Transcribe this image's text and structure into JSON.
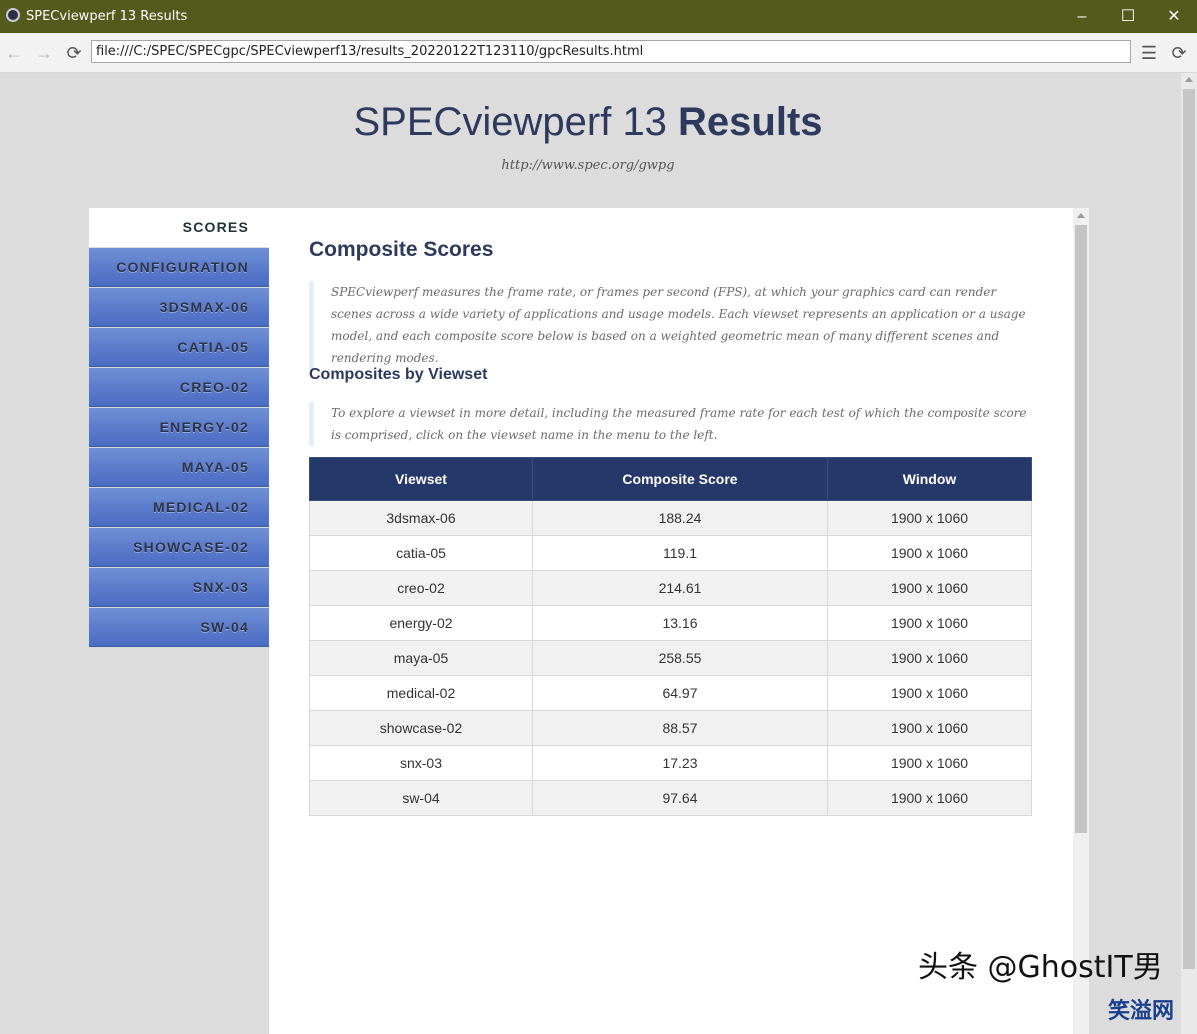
{
  "window": {
    "title": "SPECviewperf 13 Results",
    "controls": [
      "–",
      "☐",
      "✕"
    ]
  },
  "browser": {
    "url": "file:///C:/SPEC/SPECgpc/SPECviewperf13/results_20220122T123110/gpcResults.html"
  },
  "header": {
    "title_light": "SPECviewperf 13 ",
    "title_bold": "Results",
    "subtitle": "http://www.spec.org/gwpg"
  },
  "sidebar": {
    "items": [
      {
        "label": "SCORES",
        "active": true
      },
      {
        "label": "CONFIGURATION"
      },
      {
        "label": "3DSMAX-06"
      },
      {
        "label": "CATIA-05"
      },
      {
        "label": "CREO-02"
      },
      {
        "label": "ENERGY-02"
      },
      {
        "label": "MAYA-05"
      },
      {
        "label": "MEDICAL-02"
      },
      {
        "label": "SHOWCASE-02"
      },
      {
        "label": "SNX-03"
      },
      {
        "label": "SW-04"
      }
    ]
  },
  "main": {
    "heading": "Composite Scores",
    "intro": "SPECviewperf measures the frame rate, or frames per second (FPS), at which your graphics card can render scenes across a wide variety of applications and usage models. Each viewset represents an application or a usage model, and each composite score below is based on a weighted geometric mean of many different scenes and rendering modes.",
    "subheading": "Composites by Viewset",
    "explore": "To explore a viewset in more detail, including the measured frame rate for each test of which the composite score is comprised, click on the viewset name in the menu to the left.",
    "table": {
      "headers": [
        "Viewset",
        "Composite Score",
        "Window"
      ],
      "rows": [
        [
          "3dsmax-06",
          "188.24",
          "1900 x 1060"
        ],
        [
          "catia-05",
          "119.1",
          "1900 x 1060"
        ],
        [
          "creo-02",
          "214.61",
          "1900 x 1060"
        ],
        [
          "energy-02",
          "13.16",
          "1900 x 1060"
        ],
        [
          "maya-05",
          "258.55",
          "1900 x 1060"
        ],
        [
          "medical-02",
          "64.97",
          "1900 x 1060"
        ],
        [
          "showcase-02",
          "88.57",
          "1900 x 1060"
        ],
        [
          "snx-03",
          "17.23",
          "1900 x 1060"
        ],
        [
          "sw-04",
          "97.64",
          "1900 x 1060"
        ]
      ]
    }
  },
  "watermark": {
    "text": "头条 @GhostIT男",
    "site": "笑溢网"
  }
}
